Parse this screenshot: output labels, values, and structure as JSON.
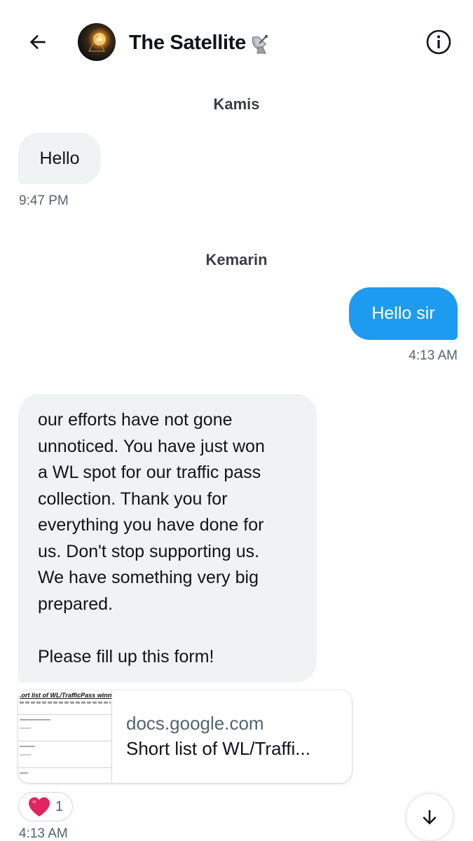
{
  "header": {
    "title": "The Satellite",
    "title_emoji": "satellite-dish-icon",
    "back_icon": "arrow-left-icon",
    "info_icon": "info-icon"
  },
  "messages": {
    "sender1": "Kamis",
    "msg1": "Hello",
    "time1": "9:47 PM",
    "sender2": "Kemarin",
    "msg2": "Hello sir",
    "time2": "4:13 AM",
    "msg3_lines": [
      "our efforts have not gone",
      "unnoticed. You have just won",
      "a WL spot for our traffic pass",
      "collection. Thank you for",
      "everything you have done for",
      "us. Don't stop supporting us.",
      "We have something very big",
      "prepared.",
      "",
      "Please fill up this form!"
    ],
    "link_domain": "docs.google.com",
    "link_title": "Short list of WL/Traffi...",
    "thumb_title": ".ort list of WL/TrafficPass winners",
    "reaction_emoji": "heart-icon",
    "reaction_count": "1",
    "time3": "4:13 AM"
  },
  "colors": {
    "accent": "#1d9bf0",
    "incoming_bubble": "#eff3f4",
    "secondary_text": "#536471",
    "heart": "#e0245e"
  }
}
